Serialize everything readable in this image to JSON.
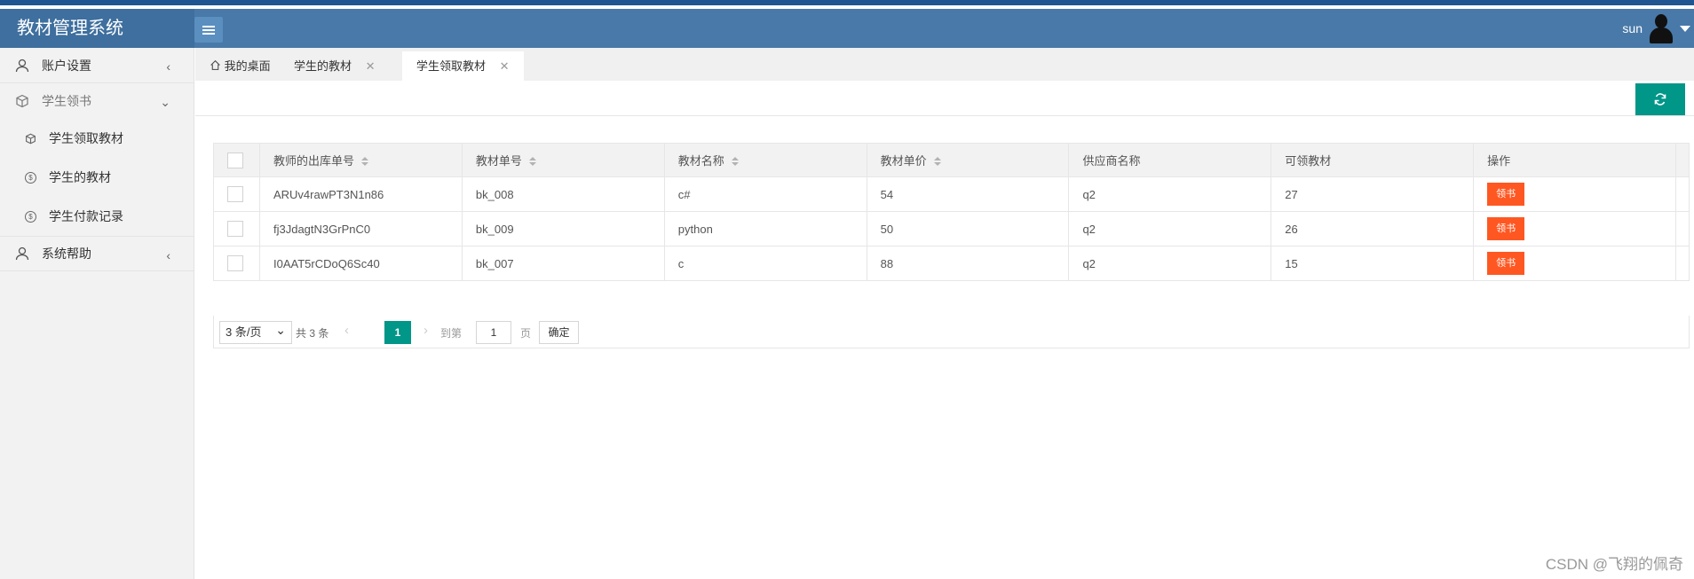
{
  "app": {
    "title": "教材管理系统",
    "user": "sun"
  },
  "sidebar": {
    "groups": [
      {
        "label": "账户设置",
        "icon": "user-icon",
        "chevron": "‹"
      },
      {
        "label": "学生领书",
        "icon": "cube-icon",
        "chevron": "⌄"
      }
    ],
    "sub_items": [
      {
        "label": "学生领取教材",
        "icon": "cube-icon"
      },
      {
        "label": "学生的教材",
        "icon": "coin-icon"
      },
      {
        "label": "学生付款记录",
        "icon": "coin-icon"
      }
    ],
    "help": {
      "label": "系统帮助",
      "icon": "user-icon",
      "chevron": "‹"
    }
  },
  "tabs": [
    {
      "label": "我的桌面",
      "icon": "home-icon"
    },
    {
      "label": "学生的教材",
      "close": "✕"
    },
    {
      "label": "学生领取教材",
      "close": "✕",
      "active": true
    }
  ],
  "table": {
    "columns": [
      "教师的出库单号",
      "教材单号",
      "教材名称",
      "教材单价",
      "供应商名称",
      "可领教材",
      "操作"
    ],
    "rows": [
      {
        "out_no": "ARUv4rawPT3N1n86",
        "book_no": "bk_008",
        "name": "c#",
        "price": "54",
        "supplier": "q2",
        "available": "27",
        "action": "领书"
      },
      {
        "out_no": "fj3JdagtN3GrPnC0",
        "book_no": "bk_009",
        "name": "python",
        "price": "50",
        "supplier": "q2",
        "available": "26",
        "action": "领书"
      },
      {
        "out_no": "I0AAT5rCDoQ6Sc40",
        "book_no": "bk_007",
        "name": "c",
        "price": "88",
        "supplier": "q2",
        "available": "15",
        "action": "领书"
      }
    ]
  },
  "pager": {
    "page_size": "3 条/页",
    "total": "共 3 条",
    "current": "1",
    "goto_label": "到第",
    "goto_value": "1",
    "unit": "页",
    "confirm": "确定"
  },
  "watermark": "CSDN @飞翔的佩奇",
  "colors": {
    "header": "#4879a8",
    "accent": "#009688",
    "action": "#ff5722"
  }
}
